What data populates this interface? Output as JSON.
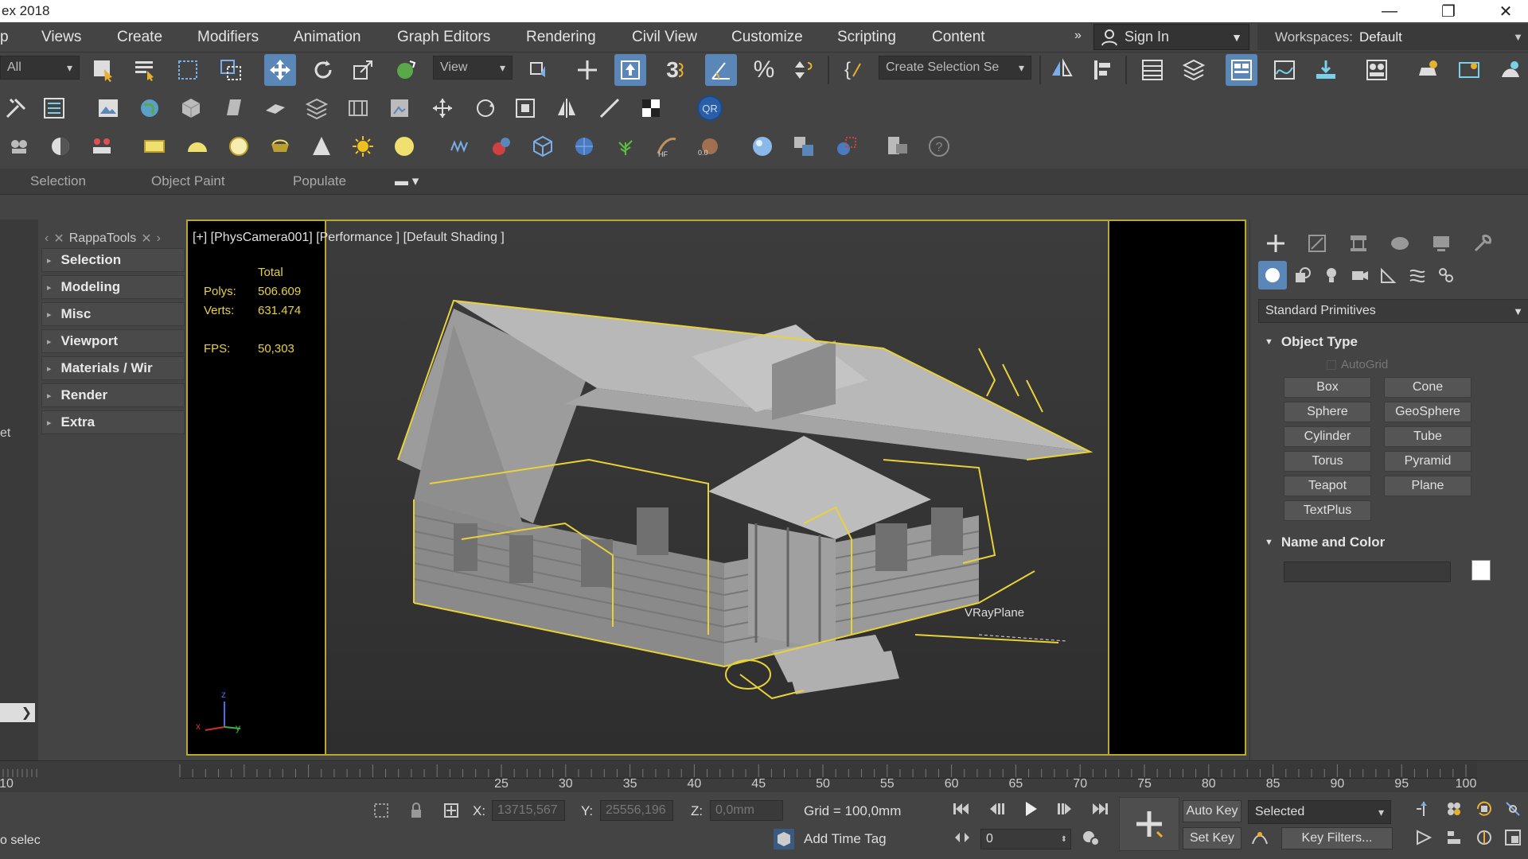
{
  "app": {
    "title": "ex 2018",
    "minimize_glyph": "—",
    "restore_glyph": "❐",
    "close_glyph": "✕"
  },
  "menu": {
    "items": [
      "p",
      "Views",
      "Create",
      "Modifiers",
      "Animation",
      "Graph Editors",
      "Rendering",
      "Civil View",
      "Customize",
      "Scripting",
      "Content"
    ],
    "overflow": "»",
    "sign_in": "Sign In",
    "workspaces_label": "Workspaces:",
    "workspace_value": "Default"
  },
  "toolbar": {
    "filter_value": "All",
    "coord_system": "View",
    "create_selection_set": "Create Selection Se",
    "snap_number": "3"
  },
  "ribbon": {
    "tabs": [
      "Selection",
      "Object Paint",
      "Populate"
    ]
  },
  "rappa": {
    "title": "RappaTools",
    "items": [
      "Selection",
      "Modeling",
      "Misc",
      "Viewport",
      "Materials / Wir",
      "Render",
      "Extra"
    ]
  },
  "left_strip": {
    "partial_label": "et"
  },
  "viewport": {
    "label": "[+] [PhysCamera001] [Performance ] [Default Shading ]",
    "stats": {
      "total_label": "Total",
      "polys_label": "Polys:",
      "polys_value": "506.609",
      "verts_label": "Verts:",
      "verts_value": "631.474",
      "fps_label": "FPS:",
      "fps_value": "50,303"
    },
    "object_label": "VRayPlane",
    "axis_x": "x",
    "axis_y": "y",
    "axis_z": "z"
  },
  "command_panel": {
    "category": "Standard Primitives",
    "object_type_title": "Object Type",
    "autogrid_label": "AutoGrid",
    "buttons": [
      "Box",
      "Cone",
      "Sphere",
      "GeoSphere",
      "Cylinder",
      "Tube",
      "Torus",
      "Pyramid",
      "Teapot",
      "Plane",
      "TextPlus"
    ],
    "name_color_title": "Name and Color",
    "name_value": "",
    "swatch_color": "#ffffff"
  },
  "timeline": {
    "ticks": [
      "10",
      "25",
      "30",
      "35",
      "40",
      "45",
      "50",
      "55",
      "60",
      "65",
      "70",
      "75",
      "80",
      "85",
      "90",
      "95",
      "100"
    ]
  },
  "status": {
    "prompt": "o selec",
    "x_label": "X:",
    "x_value": "13715,567",
    "y_label": "Y:",
    "y_value": "25556,196",
    "z_label": "Z:",
    "z_value": "0,0mm",
    "grid_label": "Grid = 100,0mm",
    "add_time_tag": "Add Time Tag",
    "auto_key": "Auto Key",
    "set_key": "Set Key",
    "selected_value": "Selected",
    "key_filters": "Key Filters...",
    "frame_value": "0"
  },
  "colors": {
    "accent": "#5a86b8",
    "selection": "#e8d23a",
    "viewport_border": "#b8a832"
  }
}
